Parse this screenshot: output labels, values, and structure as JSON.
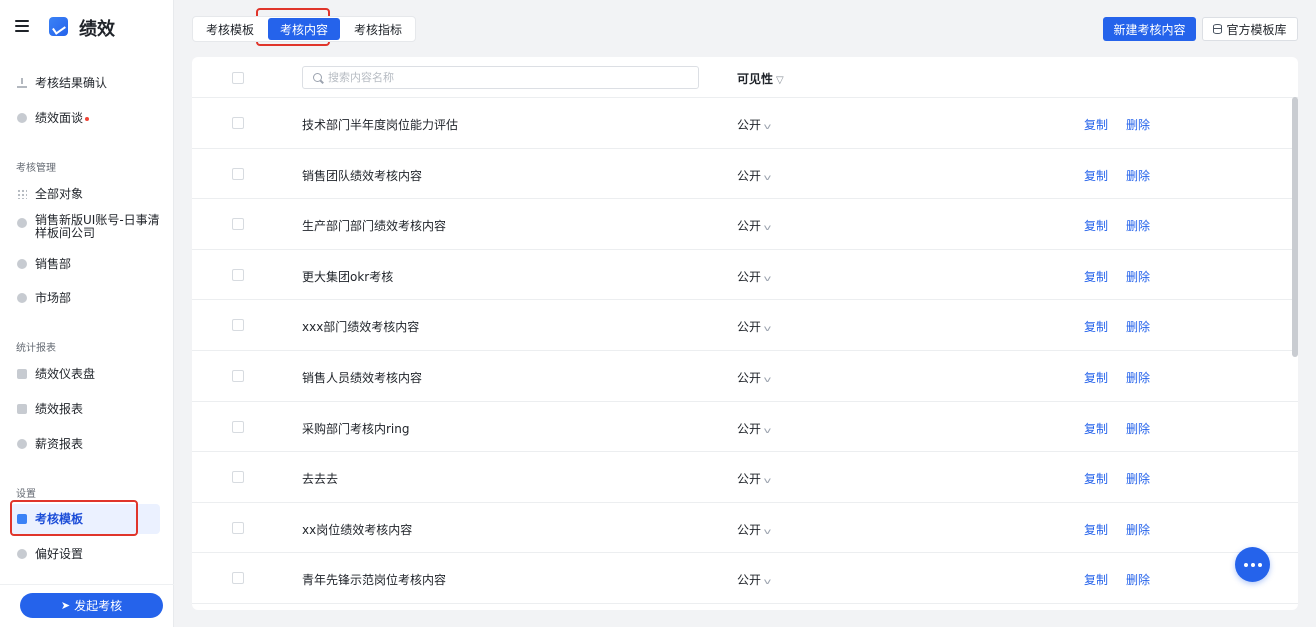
{
  "app": {
    "title": "绩效"
  },
  "sidebar": {
    "top_items": [
      {
        "label": "考核结果确认",
        "icon": "download-icon"
      },
      {
        "label": "绩效面谈",
        "icon": "chat-icon",
        "has_dot": true
      }
    ],
    "sections": [
      {
        "title": "考核管理",
        "items": [
          {
            "label": "全部对象",
            "icon": "grid-icon"
          },
          {
            "label": "销售新版UI账号-日事清样板间公司",
            "icon": "shield-icon"
          },
          {
            "label": "销售部",
            "icon": "shield-icon"
          },
          {
            "label": "市场部",
            "icon": "shield-icon"
          }
        ]
      },
      {
        "title": "统计报表",
        "items": [
          {
            "label": "绩效仪表盘",
            "icon": "monitor-icon"
          },
          {
            "label": "绩效报表",
            "icon": "report-icon"
          },
          {
            "label": "薪资报表",
            "icon": "money-bag-icon"
          }
        ]
      },
      {
        "title": "设置",
        "items": [
          {
            "label": "考核模板",
            "icon": "template-icon",
            "active": true
          },
          {
            "label": "偏好设置",
            "icon": "settings-icon"
          }
        ]
      }
    ],
    "launch_button": "发起考核"
  },
  "tabs": [
    {
      "label": "考核模板",
      "active": false
    },
    {
      "label": "考核内容",
      "active": true
    },
    {
      "label": "考核指标",
      "active": false
    }
  ],
  "toolbar": {
    "new_button": "新建考核内容",
    "library_button": "官方模板库"
  },
  "table": {
    "search_placeholder": "搜索内容名称",
    "visibility_header": "可见性",
    "copy_label": "复制",
    "delete_label": "删除",
    "rows": [
      {
        "name": "技术部门半年度岗位能力评估",
        "visibility": "公开"
      },
      {
        "name": "销售团队绩效考核内容",
        "visibility": "公开"
      },
      {
        "name": "生产部门部门绩效考核内容",
        "visibility": "公开"
      },
      {
        "name": "更大集团okr考核",
        "visibility": "公开"
      },
      {
        "name": "xxx部门绩效考核内容",
        "visibility": "公开"
      },
      {
        "name": "销售人员绩效考核内容",
        "visibility": "公开"
      },
      {
        "name": "采购部门考核内ring",
        "visibility": "公开"
      },
      {
        "name": "去去去",
        "visibility": "公开"
      },
      {
        "name": "xx岗位绩效考核内容",
        "visibility": "公开"
      },
      {
        "name": "青年先锋示范岗位考核内容",
        "visibility": "公开"
      }
    ]
  },
  "colors": {
    "primary": "#2563eb",
    "highlight": "#e0352b",
    "active_bg": "#ebf1ff"
  }
}
